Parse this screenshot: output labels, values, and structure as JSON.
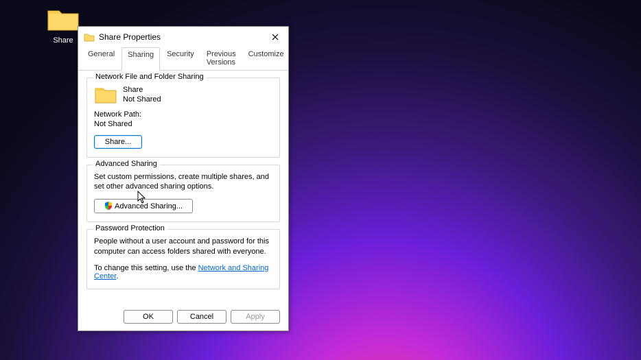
{
  "desktop": {
    "icon_label": "Share"
  },
  "dialog": {
    "title": "Share Properties",
    "tabs": [
      "General",
      "Sharing",
      "Security",
      "Previous Versions",
      "Customize"
    ],
    "active_tab": "Sharing",
    "group_network": {
      "legend": "Network File and Folder Sharing",
      "share_name": "Share",
      "share_status": "Not Shared",
      "network_path_label": "Network Path:",
      "network_path_value": "Not Shared",
      "share_button": "Share..."
    },
    "group_advanced": {
      "legend": "Advanced Sharing",
      "desc": "Set custom permissions, create multiple shares, and set other advanced sharing options.",
      "button": "Advanced Sharing..."
    },
    "group_password": {
      "legend": "Password Protection",
      "desc": "People without a user account and password for this computer can access folders shared with everyone.",
      "change_prefix": "To change this setting, use the ",
      "link_text": "Network and Sharing Center",
      "change_suffix": "."
    },
    "buttons": {
      "ok": "OK",
      "cancel": "Cancel",
      "apply": "Apply"
    }
  }
}
